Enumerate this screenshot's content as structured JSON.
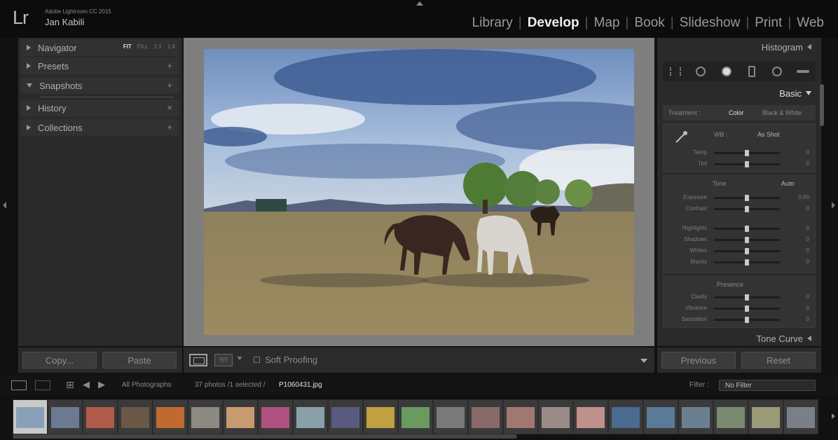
{
  "header": {
    "logo": "Lr",
    "app_name": "Adobe Lightroom CC 2015",
    "user_name": "Jan Kabili",
    "modules": [
      "Library",
      "Develop",
      "Map",
      "Book",
      "Slideshow",
      "Print",
      "Web"
    ],
    "active_module": "Develop"
  },
  "left_panel": {
    "navigator": {
      "label": "Navigator",
      "zoom": [
        "FIT",
        "FILL",
        "1:1",
        "1:4"
      ]
    },
    "presets": {
      "label": "Presets"
    },
    "snapshots": {
      "label": "Snapshots"
    },
    "history": {
      "label": "History"
    },
    "collections": {
      "label": "Collections"
    },
    "copy_button": "Copy...",
    "paste_button": "Paste"
  },
  "toolbar": {
    "soft_proofing": "Soft Proofing"
  },
  "right_panel": {
    "histogram": "Histogram",
    "basic": "Basic",
    "treatment": {
      "label": "Treatment :",
      "color": "Color",
      "bw": "Black & White"
    },
    "wb": {
      "label": "WB :",
      "value": "As Shot"
    },
    "wb_sliders": [
      {
        "label": "Temp",
        "value": "0"
      },
      {
        "label": "Tint",
        "value": "0"
      }
    ],
    "tone": {
      "label": "Tone",
      "auto": "Auto"
    },
    "tone_sliders": [
      {
        "label": "Exposure",
        "value": "0.00"
      },
      {
        "label": "Contrast",
        "value": "0"
      },
      {
        "label": "Highlights",
        "value": "0"
      },
      {
        "label": "Shadows",
        "value": "0"
      },
      {
        "label": "Whites",
        "value": "0"
      },
      {
        "label": "Blacks",
        "value": "0"
      }
    ],
    "presence": {
      "label": "Presence"
    },
    "presence_sliders": [
      {
        "label": "Clarity",
        "value": "0"
      },
      {
        "label": "Vibrance",
        "value": "0"
      },
      {
        "label": "Saturation",
        "value": "0"
      }
    ],
    "tone_curve": "Tone Curve",
    "previous_button": "Previous",
    "reset_button": "Reset"
  },
  "filmstrip": {
    "source": "All Photographs",
    "count": "37 photos /1 selected /",
    "filename": "P1060431.jpg",
    "filter_label": "Filter :",
    "filter_value": "No Filter"
  },
  "colors": {
    "bg": "#111111",
    "panel": "#2a2a2a",
    "canvas": "#7e7e7e",
    "active_text": "#f0f0f0"
  }
}
